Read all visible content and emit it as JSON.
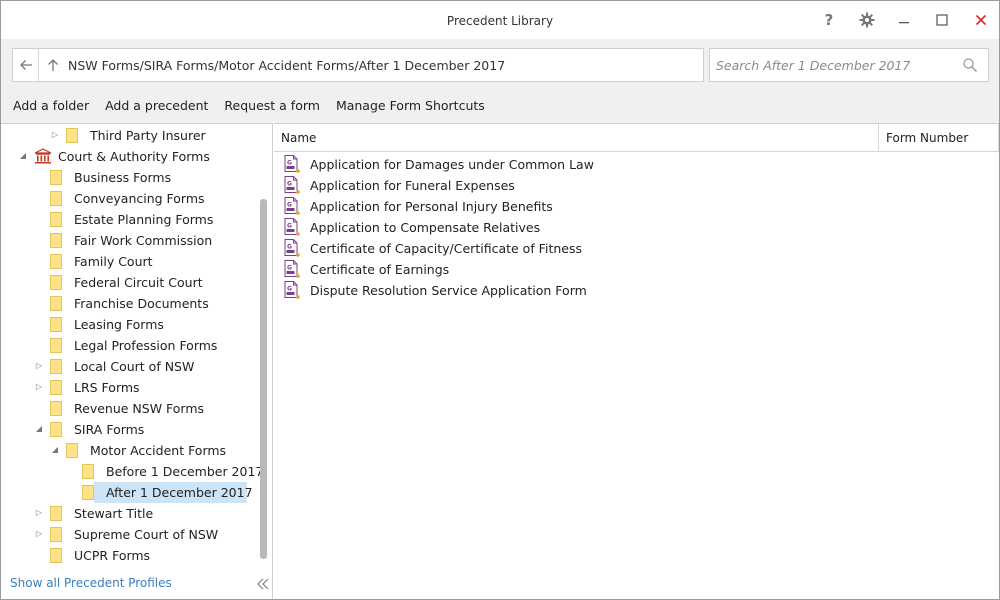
{
  "window": {
    "title": "Precedent Library",
    "help_glyph": "?",
    "min_glyph": "—",
    "max_glyph": "☐",
    "close_glyph": "✕"
  },
  "address": {
    "path": "NSW Forms/SIRA Forms/Motor Accident Forms/After 1 December 2017"
  },
  "search": {
    "placeholder": "Search After 1 December 2017"
  },
  "actions": [
    "Add a folder",
    "Add a precedent",
    "Request a form",
    "Manage Form Shortcuts"
  ],
  "tree": {
    "items": [
      {
        "label": "Third Party Insurer",
        "depth": 2,
        "expander": "collapsed",
        "icon": "folder-icon"
      },
      {
        "label": "Court & Authority Forms",
        "depth": 0,
        "expander": "expanded",
        "icon": "court-icon"
      },
      {
        "label": "Business Forms",
        "depth": 1,
        "expander": "none",
        "icon": "folder-icon"
      },
      {
        "label": "Conveyancing Forms",
        "depth": 1,
        "expander": "none",
        "icon": "folder-icon"
      },
      {
        "label": "Estate Planning Forms",
        "depth": 1,
        "expander": "none",
        "icon": "folder-icon"
      },
      {
        "label": "Fair Work Commission",
        "depth": 1,
        "expander": "none",
        "icon": "folder-icon"
      },
      {
        "label": "Family Court",
        "depth": 1,
        "expander": "none",
        "icon": "folder-icon"
      },
      {
        "label": "Federal Circuit Court",
        "depth": 1,
        "expander": "none",
        "icon": "folder-icon"
      },
      {
        "label": "Franchise Documents",
        "depth": 1,
        "expander": "none",
        "icon": "folder-icon"
      },
      {
        "label": "Leasing Forms",
        "depth": 1,
        "expander": "none",
        "icon": "folder-icon"
      },
      {
        "label": "Legal Profession Forms",
        "depth": 1,
        "expander": "none",
        "icon": "folder-icon"
      },
      {
        "label": "Local Court of NSW",
        "depth": 1,
        "expander": "collapsed",
        "icon": "folder-icon"
      },
      {
        "label": "LRS Forms",
        "depth": 1,
        "expander": "collapsed",
        "icon": "folder-icon"
      },
      {
        "label": "Revenue NSW Forms",
        "depth": 1,
        "expander": "none",
        "icon": "folder-icon"
      },
      {
        "label": "SIRA Forms",
        "depth": 1,
        "expander": "expanded",
        "icon": "folder-icon"
      },
      {
        "label": "Motor Accident Forms",
        "depth": 2,
        "expander": "expanded",
        "icon": "folder-icon"
      },
      {
        "label": "Before 1 December 2017",
        "depth": 3,
        "expander": "none",
        "icon": "folder-icon"
      },
      {
        "label": "After 1 December 2017",
        "depth": 3,
        "expander": "none",
        "icon": "folder-icon",
        "selected": true
      },
      {
        "label": "Stewart Title",
        "depth": 1,
        "expander": "collapsed",
        "icon": "folder-icon"
      },
      {
        "label": "Supreme Court of NSW",
        "depth": 1,
        "expander": "collapsed",
        "icon": "folder-icon"
      },
      {
        "label": "UCPR Forms",
        "depth": 1,
        "expander": "none",
        "icon": "folder-icon"
      }
    ],
    "show_all_label": "Show all Precedent Profiles"
  },
  "list": {
    "columns": [
      "Name",
      "Form Number"
    ],
    "rows": [
      "Application for Damages under Common Law",
      "Application for Funeral Expenses",
      "Application for Personal Injury Benefits",
      "Application to Compensate Relatives",
      "Certificate of Capacity/Certificate of Fitness",
      "Certificate of Earnings",
      "Dispute Resolution Service Application Form"
    ]
  },
  "colors": {
    "selection": "#cce4f7",
    "folder": "#ffe287",
    "link": "#3a7fc1",
    "close": "#e0282e",
    "form_icon": "#7b3f8c"
  }
}
